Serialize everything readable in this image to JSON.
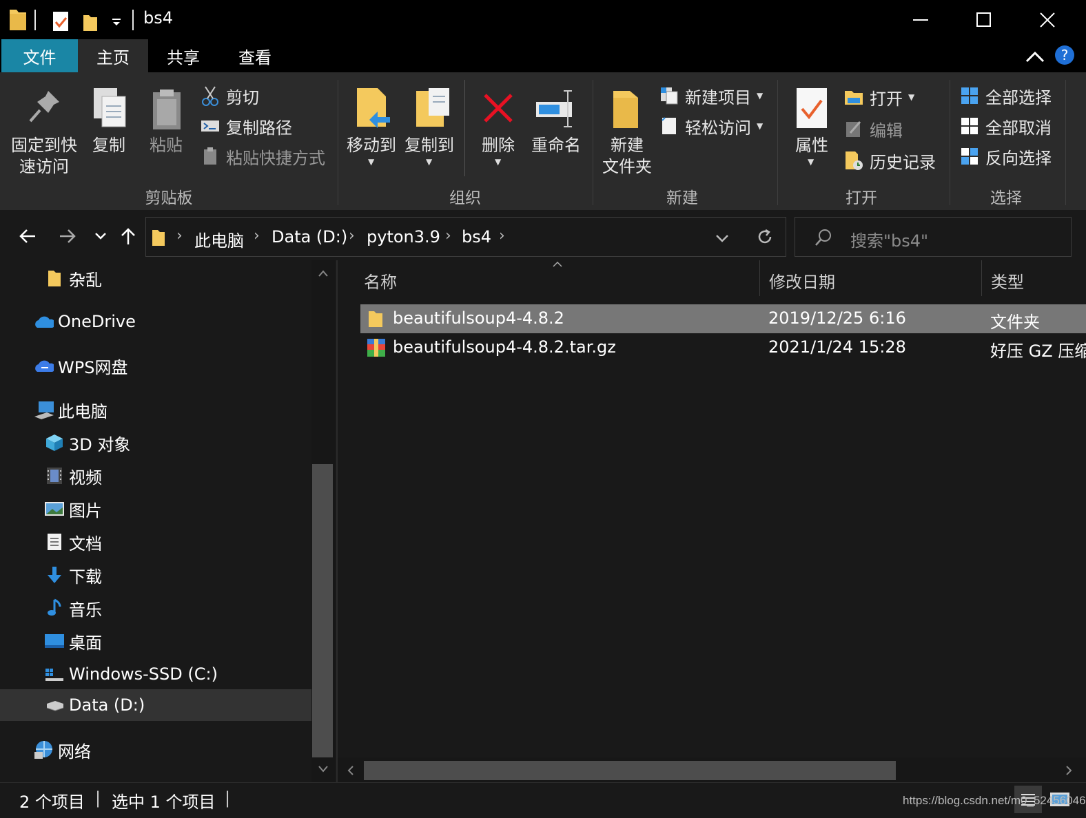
{
  "window": {
    "title": "bs4"
  },
  "tabs": {
    "file": "文件",
    "home": "主页",
    "share": "共享",
    "view": "查看"
  },
  "ribbon": {
    "clipboard": {
      "pin_label_1": "固定到快",
      "pin_label_2": "速访问",
      "copy": "复制",
      "paste": "粘贴",
      "cut": "剪切",
      "copy_path": "复制路径",
      "paste_shortcut": "粘贴快捷方式",
      "group": "剪贴板"
    },
    "organize": {
      "move_to": "移动到",
      "copy_to": "复制到",
      "delete": "删除",
      "rename": "重命名",
      "group": "组织"
    },
    "new": {
      "new_folder_1": "新建",
      "new_folder_2": "文件夹",
      "new_item": "新建项目",
      "easy_access": "轻松访问",
      "group": "新建"
    },
    "open": {
      "properties": "属性",
      "open": "打开",
      "edit": "编辑",
      "history": "历史记录",
      "group": "打开"
    },
    "select": {
      "select_all": "全部选择",
      "select_none": "全部取消",
      "invert": "反向选择",
      "group": "选择"
    }
  },
  "address": {
    "crumbs": [
      "此电脑",
      "Data (D:)",
      "pyton3.9",
      "bs4"
    ],
    "search_placeholder": "搜索\"bs4\""
  },
  "nav": [
    {
      "label": "杂乱",
      "icon": "folder-icon"
    },
    {
      "label": "OneDrive",
      "icon": "onedrive-icon"
    },
    {
      "label": "WPS网盘",
      "icon": "cloud-icon"
    },
    {
      "label": "此电脑",
      "icon": "computer-icon"
    },
    {
      "label": "3D 对象",
      "icon": "3d-objects-icon"
    },
    {
      "label": "视频",
      "icon": "video-icon"
    },
    {
      "label": "图片",
      "icon": "pictures-icon"
    },
    {
      "label": "文档",
      "icon": "documents-icon"
    },
    {
      "label": "下载",
      "icon": "download-icon"
    },
    {
      "label": "音乐",
      "icon": "music-icon"
    },
    {
      "label": "桌面",
      "icon": "desktop-icon"
    },
    {
      "label": "Windows-SSD (C:)",
      "icon": "windows-drive-icon"
    },
    {
      "label": "Data (D:)",
      "icon": "drive-icon"
    },
    {
      "label": "网络",
      "icon": "network-icon"
    }
  ],
  "files": {
    "columns": [
      "名称",
      "修改日期",
      "类型"
    ],
    "rows": [
      {
        "name": "beautifulsoup4-4.8.2",
        "date": "2019/12/25 6:16",
        "type": "文件夹",
        "icon": "folder-icon"
      },
      {
        "name": "beautifulsoup4-4.8.2.tar.gz",
        "date": "2021/1/24 15:28",
        "type": "好压 GZ 压缩",
        "icon": "archive-icon"
      }
    ]
  },
  "status": {
    "count": "2 个项目",
    "selected": "选中 1 个项目",
    "watermark": "https://blog.csdn.net/m0_52456046"
  },
  "colors": {
    "accent": "#1a86a5",
    "ribbon_bg": "#2b2b2b",
    "window_bg": "#191919",
    "selection": "#777777"
  }
}
